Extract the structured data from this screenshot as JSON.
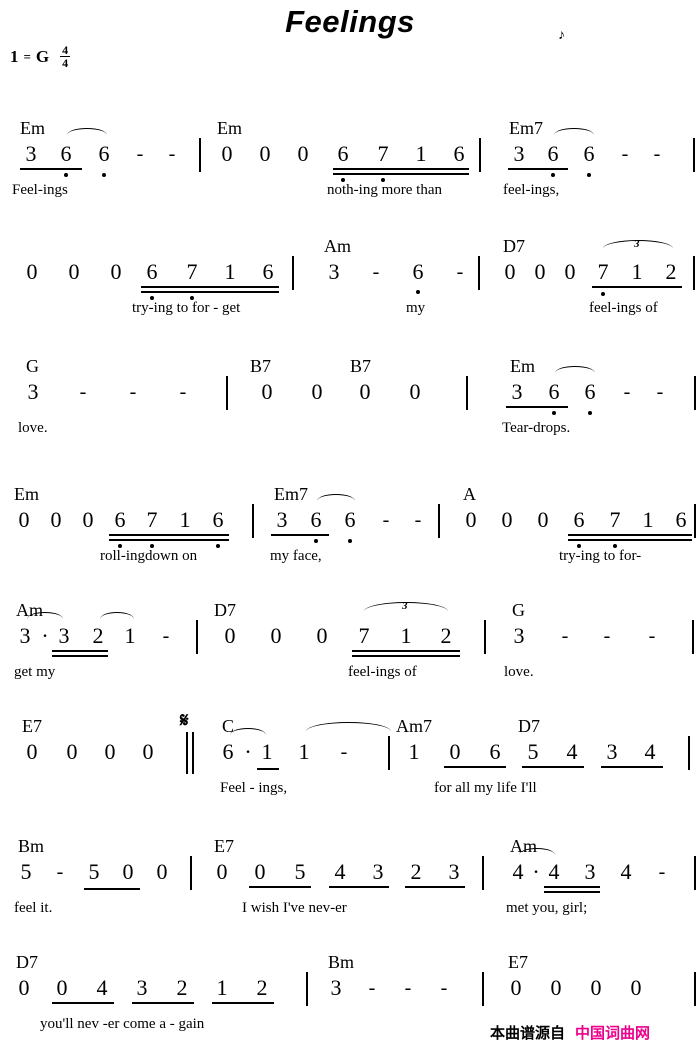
{
  "header": {
    "title": "Feelings",
    "key_label": "1",
    "key_equals": "=",
    "key_value": "G",
    "time_numerator": "4",
    "time_denominator": "4",
    "top_mark": "♪"
  },
  "systems": [
    {
      "id": "system-1",
      "measures": [
        {
          "chords": [
            "Em"
          ],
          "notes": [
            "3",
            "6",
            "6",
            "-",
            "-"
          ],
          "lyrics": "Feel-ings"
        },
        {
          "chords": [
            "Em"
          ],
          "notes": [
            "0",
            "0",
            "0",
            "6",
            "7",
            "1",
            "6"
          ],
          "lyrics": "noth-ing more than"
        },
        {
          "chords": [
            "Em7"
          ],
          "notes": [
            "3",
            "6",
            "6",
            "-",
            "-"
          ],
          "lyrics": "feel-ings,"
        }
      ]
    },
    {
      "id": "system-2",
      "measures": [
        {
          "chords": [],
          "notes": [
            "0",
            "0",
            "0",
            "6",
            "7",
            "1",
            "6"
          ],
          "lyrics": "try-ing to  for  -  get"
        },
        {
          "chords": [
            "Am"
          ],
          "notes": [
            "3",
            "-",
            "6",
            "-"
          ],
          "lyrics": "my"
        },
        {
          "chords": [
            "D7"
          ],
          "notes": [
            "0",
            "0",
            "0",
            "7",
            "1",
            "2"
          ],
          "triplet": "3",
          "lyrics": "feel-ings of"
        }
      ]
    },
    {
      "id": "system-3",
      "measures": [
        {
          "chords": [
            "G"
          ],
          "notes": [
            "3",
            "-",
            "-",
            "-"
          ],
          "lyrics": "love."
        },
        {
          "chords": [
            "B7",
            "B7"
          ],
          "notes": [
            "0",
            "0",
            "0",
            "0"
          ],
          "lyrics": ""
        },
        {
          "chords": [
            "Em"
          ],
          "notes": [
            "3",
            "6",
            "6",
            "-",
            "-"
          ],
          "lyrics": "Tear-drops."
        }
      ]
    },
    {
      "id": "system-4",
      "measures": [
        {
          "chords": [
            "Em"
          ],
          "notes": [
            "0",
            "0",
            "0",
            "6",
            "7",
            "1",
            "6"
          ],
          "lyrics": "roll-ingdown on"
        },
        {
          "chords": [
            "Em7"
          ],
          "notes": [
            "3",
            "6",
            "6",
            "-",
            "-"
          ],
          "lyrics": "my  face,"
        },
        {
          "chords": [
            "A"
          ],
          "notes": [
            "0",
            "0",
            "0",
            "6",
            "7",
            "1",
            "6"
          ],
          "lyrics": "try-ing  to for-"
        }
      ]
    },
    {
      "id": "system-5",
      "measures": [
        {
          "chords": [
            "Am"
          ],
          "notes": [
            "3",
            "·",
            "3",
            "2",
            "1",
            "-"
          ],
          "lyrics": "get     my"
        },
        {
          "chords": [
            "D7"
          ],
          "notes": [
            "0",
            "0",
            "0",
            "7",
            "1",
            "2"
          ],
          "triplet": "3",
          "lyrics": "feel-ings of"
        },
        {
          "chords": [
            "G"
          ],
          "notes": [
            "3",
            "-",
            "-",
            "-"
          ],
          "lyrics": "love."
        }
      ]
    },
    {
      "id": "system-6",
      "measures": [
        {
          "chords": [
            "E7"
          ],
          "notes": [
            "0",
            "0",
            "0",
            "0"
          ],
          "lyrics": ""
        },
        {
          "chords": [
            "C"
          ],
          "notes": [
            "6",
            "·",
            "1",
            "1",
            "-"
          ],
          "lyrics": "Feel  -  ings,"
        },
        {
          "chords": [
            "Am7",
            "D7"
          ],
          "notes": [
            "1",
            "0",
            "6",
            "5",
            "4",
            "3",
            "4"
          ],
          "lyrics": "for  all  my  life  I'll"
        }
      ],
      "segno": "𝄋"
    },
    {
      "id": "system-7",
      "measures": [
        {
          "chords": [
            "Bm"
          ],
          "notes": [
            "5",
            "-",
            "5",
            "0",
            "0"
          ],
          "lyrics": "feel    it."
        },
        {
          "chords": [
            "E7"
          ],
          "notes": [
            "0",
            "0",
            "5",
            "4",
            "3",
            "2",
            "3"
          ],
          "lyrics": "I  wish I've nev-er"
        },
        {
          "chords": [
            "Am"
          ],
          "notes": [
            "4",
            "·",
            "4",
            "3",
            "4",
            "-"
          ],
          "lyrics": "met      you, girl;"
        }
      ]
    },
    {
      "id": "system-8",
      "measures": [
        {
          "chords": [
            "D7"
          ],
          "notes": [
            "0",
            "0",
            "4",
            "3",
            "2",
            "1",
            "2"
          ],
          "lyrics": "you'll nev -er come   a   -  gain"
        },
        {
          "chords": [
            "Bm"
          ],
          "notes": [
            "3",
            "-",
            "-",
            "-"
          ],
          "lyrics": ""
        },
        {
          "chords": [
            "E7"
          ],
          "notes": [
            "0",
            "0",
            "0",
            "0"
          ],
          "lyrics": ""
        }
      ]
    }
  ],
  "footer": {
    "source_label": "本曲谱源自",
    "site_name": "中国词曲网",
    "site_color": "#ec008c"
  }
}
